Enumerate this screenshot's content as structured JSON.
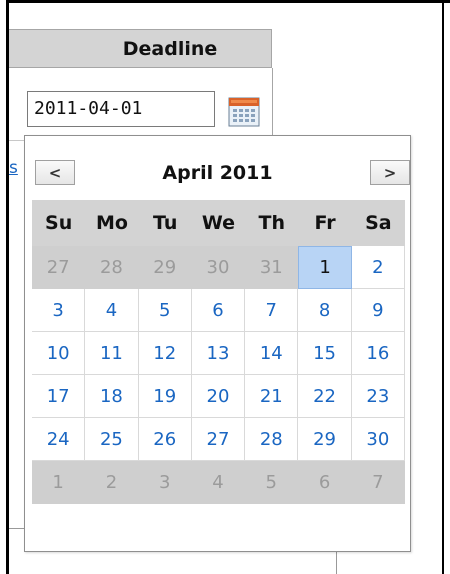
{
  "table": {
    "column_header": "Deadline",
    "date_value": "2011-04-01",
    "partial_link_text": "s"
  },
  "datepicker": {
    "prev_label": "<",
    "next_label": ">",
    "title": "April 2011",
    "weekdays": [
      "Su",
      "Mo",
      "Tu",
      "We",
      "Th",
      "Fr",
      "Sa"
    ],
    "weeks": [
      [
        {
          "d": "27",
          "other": true
        },
        {
          "d": "28",
          "other": true
        },
        {
          "d": "29",
          "other": true
        },
        {
          "d": "30",
          "other": true
        },
        {
          "d": "31",
          "other": true
        },
        {
          "d": "1",
          "selected": true
        },
        {
          "d": "2"
        }
      ],
      [
        {
          "d": "3"
        },
        {
          "d": "4"
        },
        {
          "d": "5"
        },
        {
          "d": "6"
        },
        {
          "d": "7"
        },
        {
          "d": "8"
        },
        {
          "d": "9"
        }
      ],
      [
        {
          "d": "10"
        },
        {
          "d": "11"
        },
        {
          "d": "12"
        },
        {
          "d": "13"
        },
        {
          "d": "14"
        },
        {
          "d": "15"
        },
        {
          "d": "16"
        }
      ],
      [
        {
          "d": "17"
        },
        {
          "d": "18"
        },
        {
          "d": "19"
        },
        {
          "d": "20"
        },
        {
          "d": "21"
        },
        {
          "d": "22"
        },
        {
          "d": "23"
        }
      ],
      [
        {
          "d": "24"
        },
        {
          "d": "25"
        },
        {
          "d": "26"
        },
        {
          "d": "27"
        },
        {
          "d": "28"
        },
        {
          "d": "29"
        },
        {
          "d": "30"
        }
      ],
      [
        {
          "d": "1",
          "other": true
        },
        {
          "d": "2",
          "other": true
        },
        {
          "d": "3",
          "other": true
        },
        {
          "d": "4",
          "other": true
        },
        {
          "d": "5",
          "other": true
        },
        {
          "d": "6",
          "other": true
        },
        {
          "d": "7",
          "other": true
        }
      ]
    ]
  },
  "icons": {
    "calendar": "calendar-icon"
  },
  "colors": {
    "link_blue": "#1a66c2",
    "selected_day_bg": "#b8d4f5",
    "other_month_bg": "#cfcfcf",
    "header_bg": "#d4d4d4"
  }
}
